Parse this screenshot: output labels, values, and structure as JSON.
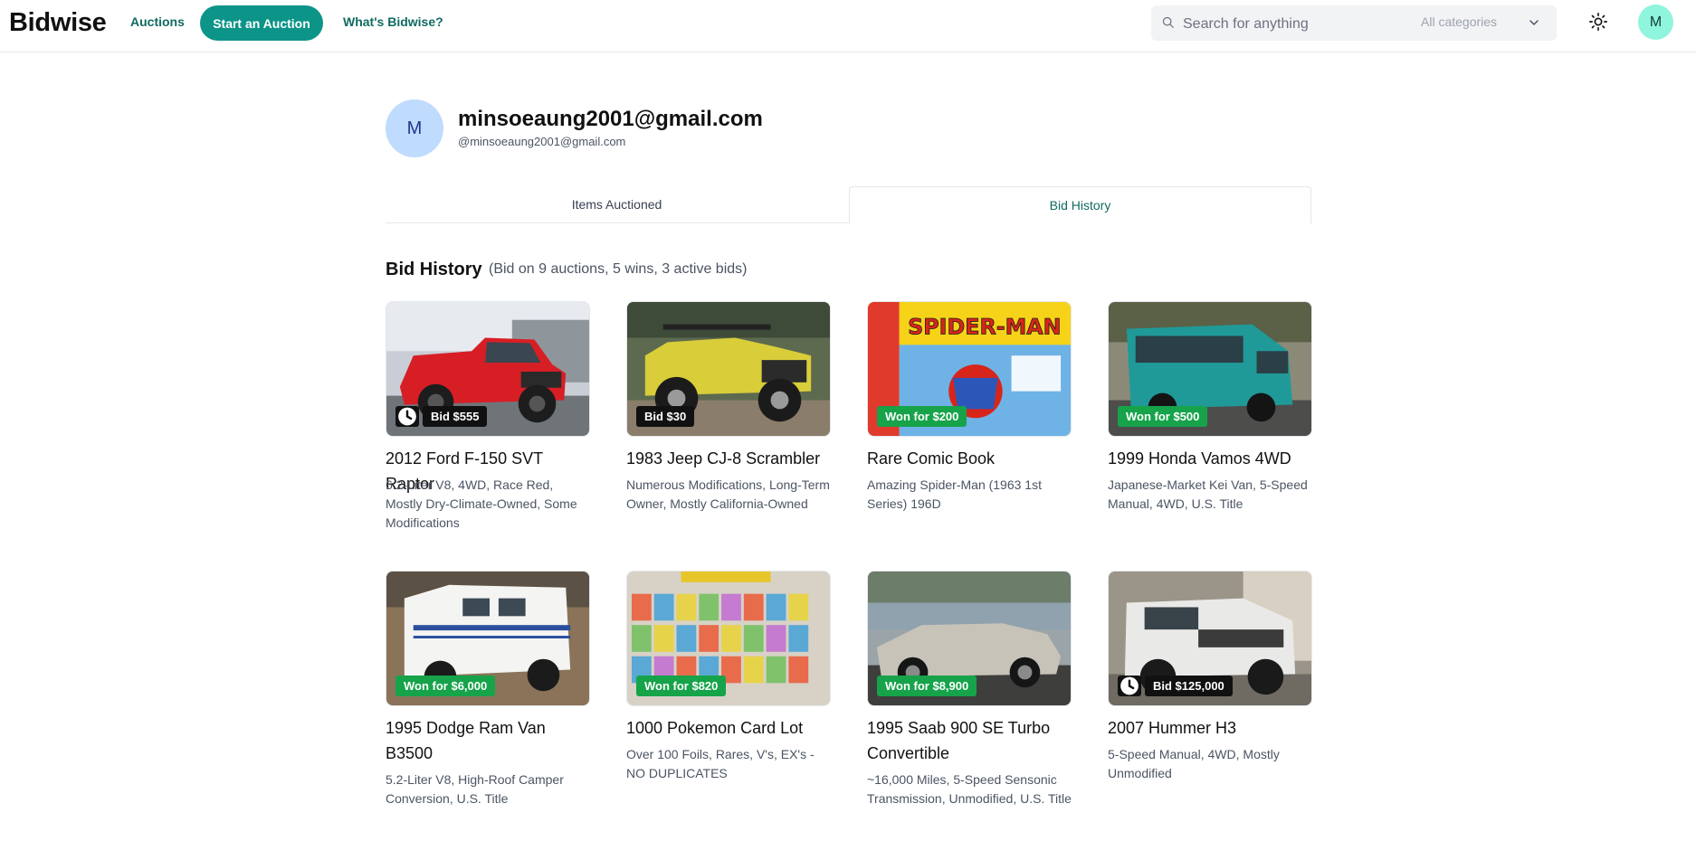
{
  "header": {
    "logo": "Bidwise",
    "nav_auctions": "Auctions",
    "start_auction": "Start an Auction",
    "whats_bidwise": "What's Bidwise?",
    "search_placeholder": "Search for anything",
    "category_selected": "All categories",
    "avatar_initial": "M"
  },
  "profile": {
    "initial": "M",
    "name": "minsoeaung2001@gmail.com",
    "handle": "@minsoeaung2001@gmail.com"
  },
  "tabs": {
    "items_auctioned": "Items Auctioned",
    "bid_history": "Bid History"
  },
  "section": {
    "title": "Bid History",
    "subtitle": "(Bid on 9 auctions, 5 wins, 3 active bids)"
  },
  "cards": [
    {
      "title": "2012 Ford F-150 SVT Raptor",
      "description": "6.2-Liter V8, 4WD, Race Red, Mostly Dry-Climate-Owned, Some Modifications",
      "badge": "Bid $555",
      "status": "bid",
      "clock": true
    },
    {
      "title": "1983 Jeep CJ-8 Scrambler",
      "description": "Numerous Modifications, Long-Term Owner, Mostly California-Owned",
      "badge": "Bid $30",
      "status": "bid",
      "clock": false
    },
    {
      "title": "Rare Comic Book",
      "description": "Amazing Spider-Man (1963 1st Series) 196D",
      "badge": "Won for $200",
      "status": "won",
      "clock": false,
      "image_text": "SPIDER-MAN"
    },
    {
      "title": "1999 Honda Vamos 4WD",
      "description": "Japanese-Market Kei Van, 5-Speed Manual, 4WD, U.S. Title",
      "badge": "Won for $500",
      "status": "won",
      "clock": false
    },
    {
      "title": "1995 Dodge Ram Van B3500",
      "description": "5.2-Liter V8, High-Roof Camper Conversion, U.S. Title",
      "badge": "Won for $6,000",
      "status": "won",
      "clock": false
    },
    {
      "title": "1000 Pokemon Card Lot",
      "description": "Over 100 Foils, Rares, V's, EX's - NO DUPLICATES",
      "badge": "Won for $820",
      "status": "won",
      "clock": false
    },
    {
      "title": "1995 Saab 900 SE Turbo Convertible",
      "description": "~16,000 Miles, 5-Speed Sensonic Transmission, Unmodified, U.S. Title",
      "badge": "Won for $8,900",
      "status": "won",
      "clock": false
    },
    {
      "title": "2007 Hummer H3",
      "description": "5-Speed Manual, 4WD, Mostly Unmodified",
      "badge": "Bid $125,000",
      "status": "bid",
      "clock": true
    }
  ],
  "colors": {
    "accent": "#0d9488",
    "won": "#16a34a",
    "bid": "#111111"
  }
}
